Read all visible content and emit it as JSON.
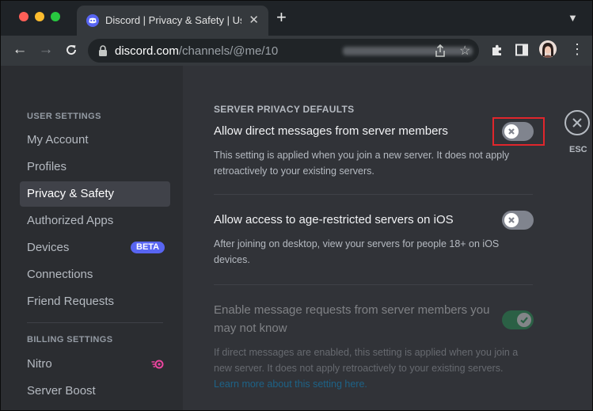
{
  "colors": {
    "mac_close": "#ff5f57",
    "mac_minimize": "#febc2e",
    "mac_maximize": "#28c840",
    "discord_blurple": "#5865f2",
    "toggle_off": "#80848e",
    "toggle_on": "#23a55a",
    "highlight_box": "#e0262c",
    "link": "#00a8fc"
  },
  "browser": {
    "tab_title": "Discord | Privacy & Safety | User Settings",
    "url_host": "discord.com",
    "url_path": "/channels/@me/10"
  },
  "sidebar": {
    "user_settings_header": "USER SETTINGS",
    "user_items": [
      {
        "label": "My Account"
      },
      {
        "label": "Profiles"
      },
      {
        "label": "Privacy & Safety",
        "selected": true
      },
      {
        "label": "Authorized Apps"
      },
      {
        "label": "Devices",
        "badge": "BETA"
      },
      {
        "label": "Connections"
      },
      {
        "label": "Friend Requests"
      }
    ],
    "billing_settings_header": "BILLING SETTINGS",
    "billing_items": [
      {
        "label": "Nitro"
      },
      {
        "label": "Server Boost"
      }
    ]
  },
  "main": {
    "section_header": "SERVER PRIVACY DEFAULTS",
    "options": [
      {
        "title": "Allow direct messages from server members",
        "description_line1": "This setting is applied when you join a new server. It does not apply",
        "description_line2": "retroactively to your existing servers.",
        "enabled": false
      },
      {
        "title": "Allow access to age-restricted servers on iOS",
        "description_line1": "After joining on desktop, view your servers for people 18+ on iOS",
        "description_line2": "devices.",
        "enabled": false
      },
      {
        "title_line1": "Enable message requests from server members you",
        "title_line2": "may not know",
        "description_line1": "If direct messages are enabled, this setting is applied when you join a",
        "description_line2": "new server. It does not apply retroactively to your existing servers.",
        "link_text": "Learn more about this setting here.",
        "enabled": true,
        "disabled": true
      }
    ],
    "close_label": "ESC"
  }
}
